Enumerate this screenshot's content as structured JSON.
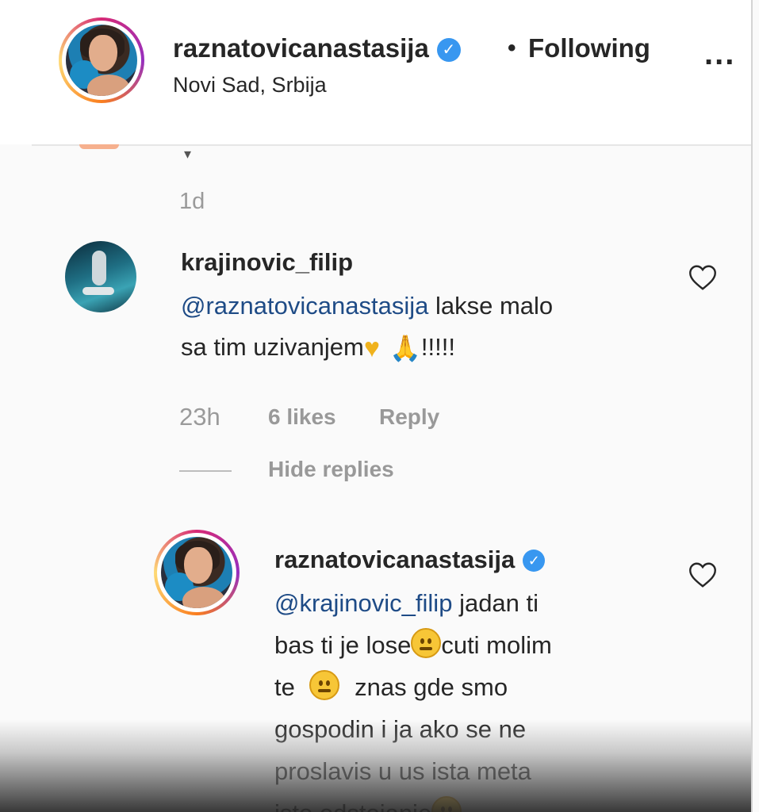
{
  "header": {
    "username": "raznatovicanastasija",
    "verified": true,
    "separator": "•",
    "follow_status": "Following",
    "more_label": "...",
    "location": "Novi Sad, Srbija"
  },
  "thread": {
    "previous_timestamp": "1d",
    "comment": {
      "username": "krajinovic_filip",
      "mention": "@raznatovicanastasija",
      "text_line1": "lakse malo",
      "text_line2": "sa tim uzivanjem",
      "text_trail": "!!!!!",
      "time": "23h",
      "likes": "6 likes",
      "reply_label": "Reply",
      "hide_replies_label": "Hide replies"
    },
    "reply": {
      "username": "raznatovicanastasija",
      "verified": true,
      "mention": "@krajinovic_filip",
      "line1_rest": "jadan ti",
      "line2_a": "bas ti je lose",
      "line2_b": "cuti molim",
      "line3_a": "te",
      "line3_b": "znas gde smo",
      "line4": "gospodin i ja ako se ne",
      "line5": "proslavis u us ista meta",
      "line6": "isto odstojanje"
    }
  },
  "icons": {
    "verified_glyph": "✓",
    "heart_emoji": "♥",
    "pray_emoji": "🙏"
  },
  "colors": {
    "verified_blue": "#3897f0",
    "mention_blue": "#1e4b86",
    "muted_gray": "#999999"
  }
}
